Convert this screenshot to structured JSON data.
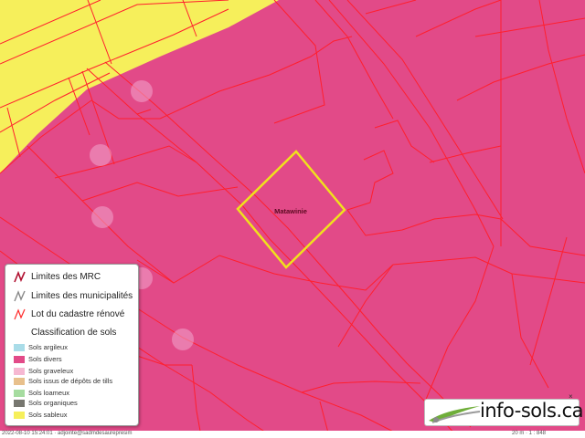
{
  "map": {
    "lot_label": "Matawinie",
    "colors": {
      "sols_divers": "#e24a88",
      "sols_sableux": "#f6ef5b",
      "cadastre_line": "#ff1f2e",
      "selection": "#f0e21c"
    }
  },
  "legend": {
    "lines": [
      {
        "label": "Limites des MRC",
        "color": "#b01030",
        "icon": "mrc-line-icon"
      },
      {
        "label": "Limites des municipalités",
        "color": "#888888",
        "icon": "municipality-line-icon"
      },
      {
        "label": "Lot du cadastre rénové",
        "color": "#ff2a2a",
        "icon": "cadastre-line-icon"
      }
    ],
    "classification_title": "Classification de sols",
    "classes": [
      {
        "label": "Sols argileux",
        "color": "#a9dce8"
      },
      {
        "label": "Sols divers",
        "color": "#e24a88"
      },
      {
        "label": "Sols graveleux",
        "color": "#f6b8d2"
      },
      {
        "label": "Sols issus de dépôts de tills",
        "color": "#e8c08c"
      },
      {
        "label": "Sols loameux",
        "color": "#a6dca0"
      },
      {
        "label": "Sols organiques",
        "color": "#777770"
      },
      {
        "label": "Sols sableux",
        "color": "#f6ef5b"
      }
    ]
  },
  "logo": {
    "text": "info-sols.ca",
    "close": "×"
  },
  "footer": {
    "timestamp": "2022-08-10 15:24:01 · adjointe@sadmdesaurepresim",
    "scale": "20 m  ·  1 : 848"
  }
}
